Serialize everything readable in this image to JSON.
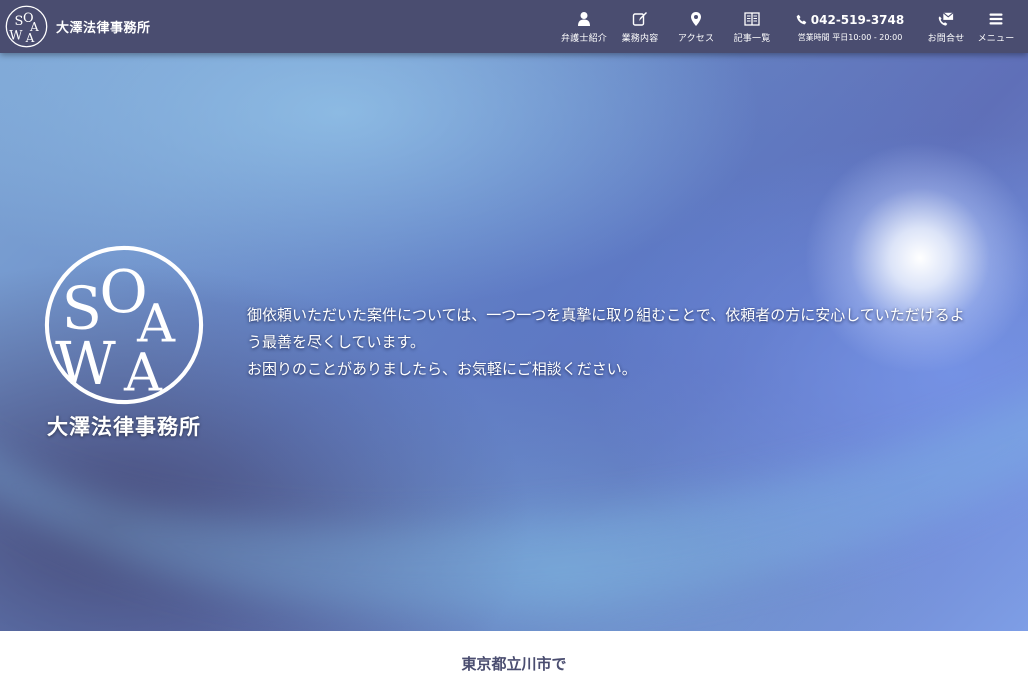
{
  "header": {
    "brand_name": "大澤法律事務所",
    "bg_color": "#4a4d70",
    "nav": [
      {
        "label": "弁護士紹介",
        "icon": "person-icon"
      },
      {
        "label": "業務内容",
        "icon": "edit-icon"
      },
      {
        "label": "アクセス",
        "icon": "map-pin-icon"
      },
      {
        "label": "記事一覧",
        "icon": "book-icon"
      }
    ],
    "phone": {
      "number": "042-519-3748",
      "hours": "営業時間 平日10:00 - 20:00",
      "icon": "phone-icon"
    },
    "contact": {
      "label": "お問合せ",
      "icon": "mail-phone-icon"
    },
    "menu": {
      "label": "メニュー",
      "icon": "hamburger-icon"
    }
  },
  "hero": {
    "logo_name": "大澤法律事務所",
    "logo_letters": "SOAWA",
    "lines": [
      "御依頼いただいた案件については、一つ一つを真摯に取り組むことで、依頼者の方に安心していただけるよ",
      "う最善を尽くしています。",
      "お困りのことがありましたら、お気軽にご相談ください。"
    ]
  },
  "below": {
    "title": "東京都立川市で"
  }
}
